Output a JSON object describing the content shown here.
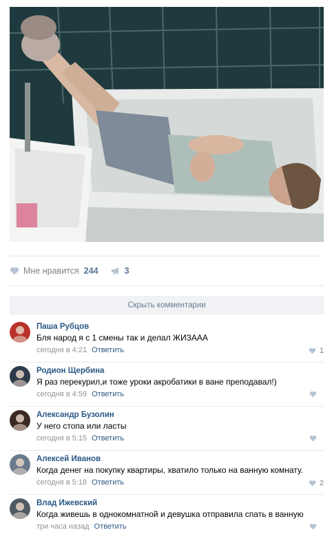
{
  "photo": {
    "alt_icon": "bathtub-photo"
  },
  "actions": {
    "like_label": "Мне нравится",
    "like_count": "244",
    "share_count": "3"
  },
  "hide_comments_label": "Скрыть комментарии",
  "comments": [
    {
      "author": "Паша Рубцов",
      "text": "Бля народ я с 1 смены так и делал ЖИЗААА",
      "time": "сегодня в 4:21",
      "reply": "Ответить",
      "likes": "1",
      "avatar_color": "#b8322b"
    },
    {
      "author": "Родион Щербина",
      "text": "Я раз перекурил,и тоже уроки акробатики в ване преподавал!)",
      "time": "сегодня в 4:59",
      "reply": "Ответить",
      "likes": "",
      "avatar_color": "#2d3a4a"
    },
    {
      "author": "Александр Бузолин",
      "text": "У него стопа или ласты",
      "time": "сегодня в 5:15",
      "reply": "Ответить",
      "likes": "",
      "avatar_color": "#3a2a22"
    },
    {
      "author": "Алексей Иванов",
      "text": "Когда денег на покупку квартиры, хватило только на ванную комнату.",
      "time": "сегодня в 5:18",
      "reply": "Ответить",
      "likes": "2",
      "avatar_color": "#6a7a8e"
    },
    {
      "author": "Влад Ижевский",
      "text": "Когда живешь в однокомнатной и девушка отправила спать в ванную",
      "time": "три часа назад",
      "reply": "Ответить",
      "likes": "",
      "avatar_color": "#505a62"
    }
  ],
  "colors": {
    "link": "#2a5885",
    "muted": "#939393",
    "accent_count": "#5b7594",
    "bar_bg": "#f0f2f5"
  }
}
